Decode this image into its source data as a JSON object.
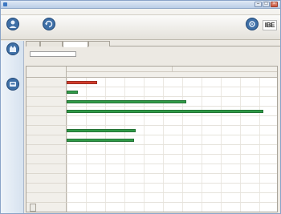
{
  "window": {
    "title": "",
    "controls": {
      "minimize": "–",
      "maximize": "□",
      "close": "×"
    }
  },
  "menu": {
    "items": [
      {
        "label": ""
      }
    ]
  },
  "toolbar": {
    "tools": [
      {
        "label": "",
        "icon": "user-icon"
      },
      {
        "label": "",
        "icon": "refresh-icon"
      }
    ],
    "display_button": {
      "label": "",
      "icon": "display-icon"
    },
    "logo_text": "IBE"
  },
  "sidebar": {
    "items": [
      {
        "label": "",
        "icon": "production-icon"
      },
      {
        "label": "",
        "icon": "machine-icon"
      }
    ]
  },
  "tabs": [
    {
      "label": ""
    },
    {
      "label": ""
    },
    {
      "label": "",
      "active": true
    },
    {
      "label": ""
    }
  ],
  "date_filter": {
    "label": "",
    "value": ""
  },
  "gantt": {
    "months": [
      {
        "label": ""
      },
      {
        "label": ""
      }
    ],
    "days": [
      "",
      "",
      "",
      "",
      "",
      "",
      "",
      "",
      "",
      "",
      ""
    ],
    "rows": [
      {
        "label": ""
      },
      {
        "label": ""
      },
      {
        "label": ""
      },
      {
        "label": ""
      },
      {
        "label": ""
      },
      {
        "label": ""
      },
      {
        "label": ""
      },
      {
        "label": ""
      },
      {
        "label": ""
      },
      {
        "label": ""
      },
      {
        "label": ""
      },
      {
        "label": ""
      },
      {
        "label": ""
      },
      {
        "label": ""
      }
    ],
    "bars": [
      {
        "row": 0,
        "start_day": 0,
        "end_day": 1.6,
        "status": "late",
        "label": ""
      },
      {
        "row": 1,
        "start_day": 0,
        "end_day": 0.6,
        "status": "planned",
        "label": ""
      },
      {
        "row": 2,
        "start_day": 0,
        "end_day": 6.2,
        "status": "planned",
        "label": ""
      },
      {
        "row": 3,
        "start_day": 0,
        "end_day": 10.2,
        "status": "planned",
        "label": ""
      },
      {
        "row": 5,
        "start_day": 0,
        "end_day": 3.6,
        "status": "planned",
        "label": ""
      },
      {
        "row": 6,
        "start_day": 0,
        "end_day": 3.5,
        "status": "planned",
        "label": ""
      }
    ],
    "colors": {
      "planned": "#2f9a47",
      "late": "#d23c2c"
    }
  }
}
